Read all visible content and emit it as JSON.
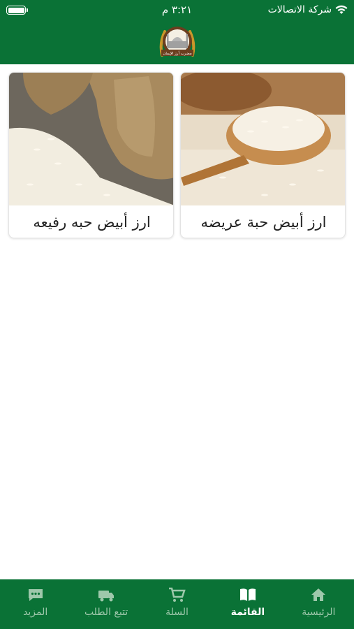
{
  "status_bar": {
    "carrier": "شركة الاتصالات",
    "time": "٣:٢١ م"
  },
  "header": {
    "logo_icon": "mosque-logo-icon",
    "logo_text": "مضرب أرز الإيمان",
    "background_color": "#0a7236"
  },
  "products": [
    {
      "name": "ارز أبيض حبة عريضه",
      "image": "rice-spoon-image"
    },
    {
      "name": "ارز أبيض حبه رفيعه",
      "image": "rice-sack-image"
    }
  ],
  "tabbar": {
    "active_index": 1,
    "tabs": [
      {
        "label": "الرئيسية",
        "icon": "home-icon"
      },
      {
        "label": "القائمة",
        "icon": "menu-book-icon"
      },
      {
        "label": "السلة",
        "icon": "cart-icon"
      },
      {
        "label": "تتبع الطلب",
        "icon": "delivery-truck-icon"
      },
      {
        "label": "المزيد",
        "icon": "more-chat-icon"
      }
    ]
  }
}
